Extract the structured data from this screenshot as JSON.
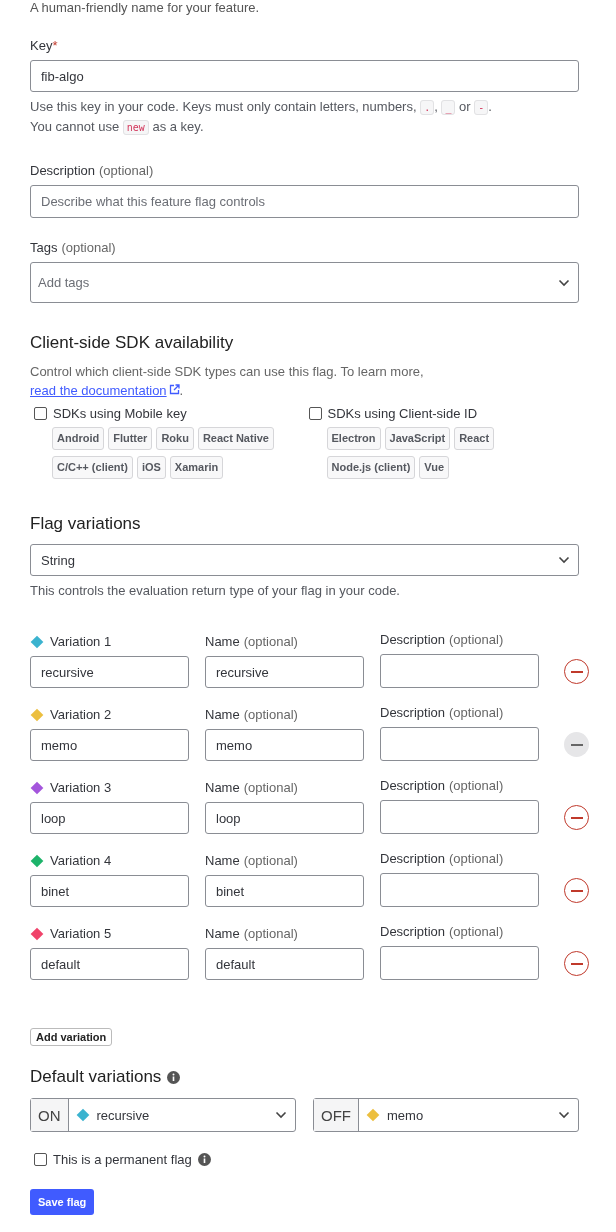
{
  "intro": "A human-friendly name for your feature.",
  "key": {
    "label": "Key",
    "required_mark": "*",
    "value": "fib-algo",
    "help": [
      {
        "kind": "text",
        "text": "Use this key in your code. Keys must only contain letters, numbers, "
      },
      {
        "kind": "code",
        "text": "."
      },
      {
        "kind": "text",
        "text": ", "
      },
      {
        "kind": "code",
        "text": "_"
      },
      {
        "kind": "text",
        "text": " or "
      },
      {
        "kind": "code",
        "text": "-"
      },
      {
        "kind": "text",
        "text": "."
      },
      {
        "kind": "break"
      },
      {
        "kind": "text",
        "text": "You cannot use "
      },
      {
        "kind": "code",
        "text": "new"
      },
      {
        "kind": "text",
        "text": " as a key."
      }
    ]
  },
  "description": {
    "label": "Description",
    "hint": "(optional)",
    "placeholder": "Describe what this feature flag controls"
  },
  "tags": {
    "label": "Tags",
    "hint": "(optional)",
    "placeholder": "Add tags"
  },
  "sdk": {
    "title": "Client-side SDK availability",
    "text": "Control which client-side SDK types can use this flag. To learn more, ",
    "link": "read the documentation",
    "after": ".",
    "groups": [
      {
        "label": "SDKs using Mobile key",
        "checked": false,
        "chips": [
          [
            "Android",
            "Flutter",
            "Roku",
            "React Native"
          ],
          [
            "C/C++ (client)",
            "iOS",
            "Xamarin"
          ]
        ]
      },
      {
        "label": "SDKs using Client-side ID",
        "checked": false,
        "chips": [
          [
            "Electron",
            "JavaScript",
            "React"
          ],
          [
            "Node.js (client)",
            "Vue"
          ]
        ]
      }
    ]
  },
  "flag_variations": {
    "title": "Flag variations",
    "type": "String",
    "help": "This controls the evaluation return type of your flag in your code."
  },
  "variations": [
    {
      "label": "Variation 1",
      "color": "#3bb3cf",
      "value": "recursive",
      "name_label": "Name",
      "name_hint": "(optional)",
      "name": "recursive",
      "desc_label": "Description",
      "desc_hint": "(optional)",
      "remove_disabled": false
    },
    {
      "label": "Variation 2",
      "color": "#ecbf3f",
      "value": "memo",
      "name_label": "Name",
      "name_hint": "(optional)",
      "name": "memo",
      "desc_label": "Description",
      "desc_hint": "(optional)",
      "remove_disabled": true
    },
    {
      "label": "Variation 3",
      "color": "#a455dc",
      "value": "loop",
      "name_label": "Name",
      "name_hint": "(optional)",
      "name": "loop",
      "desc_label": "Description",
      "desc_hint": "(optional)",
      "remove_disabled": false
    },
    {
      "label": "Variation 4",
      "color": "#1db36a",
      "value": "binet",
      "name_label": "Name",
      "name_hint": "(optional)",
      "name": "binet",
      "desc_label": "Description",
      "desc_hint": "(optional)",
      "remove_disabled": false
    },
    {
      "label": "Variation 5",
      "color": "#f0436a",
      "value": "default",
      "name_label": "Name",
      "name_hint": "(optional)",
      "name": "default",
      "desc_label": "Description",
      "desc_hint": "(optional)",
      "remove_disabled": false
    }
  ],
  "add_variation": "Add variation",
  "defaults": {
    "title": "Default variations",
    "selects": [
      {
        "label": "ON",
        "value": "recursive",
        "color": "#3bb3cf"
      },
      {
        "label": "OFF",
        "value": "memo",
        "color": "#ecbf3f"
      }
    ]
  },
  "permanent": {
    "label": "This is a permanent flag",
    "checked": false
  },
  "save": "Save flag"
}
